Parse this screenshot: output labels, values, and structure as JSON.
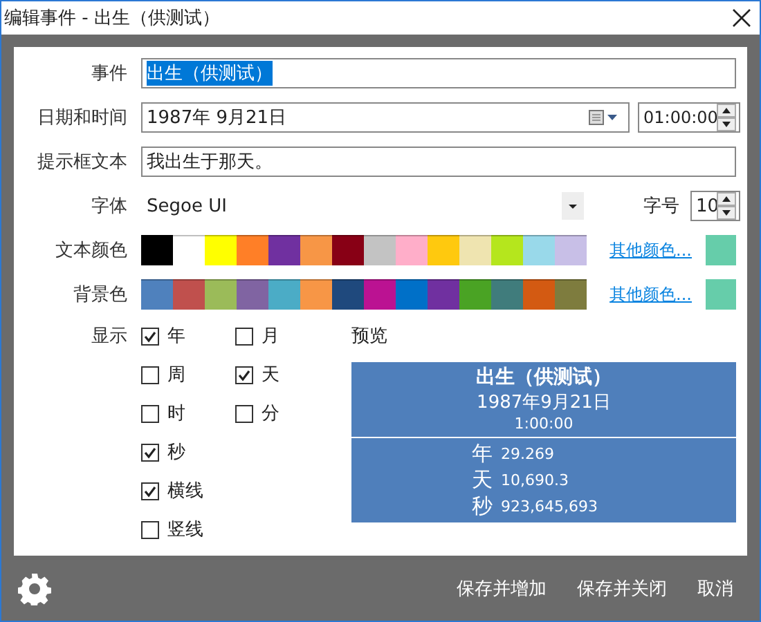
{
  "window": {
    "title": "编辑事件 - 出生（供测试）"
  },
  "event": {
    "label": "事件",
    "value": "出生（供测试）",
    "text_selected": true
  },
  "datetime": {
    "label": "日期和时间",
    "date": "1987年  9月21日",
    "time": "01:00:00"
  },
  "tooltip": {
    "label": "提示框文本",
    "value": "我出生于那天。"
  },
  "font": {
    "label": "字体",
    "value": "Segoe UI",
    "size_label": "字号",
    "size": "10"
  },
  "text_color": {
    "label": "文本颜色",
    "more_link": "其他颜色...",
    "custom_swatch": {
      "color": "#66cdaa"
    },
    "swatches": [
      {
        "color": "#000000"
      },
      {
        "color": "#ffffff"
      },
      {
        "color": "#ffff00"
      },
      {
        "color": "#ff7f27"
      },
      {
        "color": "#7030a0"
      },
      {
        "color": "#f79646"
      },
      {
        "color": "#880015"
      },
      {
        "color": "#c3c3c3"
      },
      {
        "color": "#ffaec9"
      },
      {
        "color": "#ffc90e"
      },
      {
        "color": "#efe4b0"
      },
      {
        "color": "#b5e61d"
      },
      {
        "color": "#99d9ea"
      },
      {
        "color": "#c8bfe7"
      }
    ]
  },
  "background_color": {
    "label": "背景色",
    "more_link": "其他颜色...",
    "custom_swatch": {
      "color": "#66cdaa"
    },
    "swatches": [
      {
        "color": "#4f81bd"
      },
      {
        "color": "#c0504d"
      },
      {
        "color": "#9bbb59"
      },
      {
        "color": "#8064a2"
      },
      {
        "color": "#4bacc6"
      },
      {
        "color": "#f79646"
      },
      {
        "color": "#1f497d"
      },
      {
        "color": "#bb1292"
      },
      {
        "color": "#0070c8"
      },
      {
        "color": "#7030a0"
      },
      {
        "color": "#4aa324"
      },
      {
        "color": "#407c7c"
      },
      {
        "color": "#d35a12"
      },
      {
        "color": "#7e7c3e"
      }
    ]
  },
  "display": {
    "label": "显示",
    "columns": [
      [
        {
          "label": "年",
          "checked": true
        },
        {
          "label": "周",
          "checked": false
        },
        {
          "label": "时",
          "checked": false
        },
        {
          "label": "秒",
          "checked": true
        },
        {
          "label": "横线",
          "checked": true
        },
        {
          "label": "竖线",
          "checked": false
        }
      ],
      [
        {
          "label": "月",
          "checked": false
        },
        {
          "label": "天",
          "checked": true
        },
        {
          "label": "分",
          "checked": false
        }
      ]
    ]
  },
  "preview": {
    "label": "预览",
    "title": "出生（供测试）",
    "date": "1987年9月21日",
    "time": "1:00:00",
    "stats": [
      {
        "unit": "年",
        "value": "29.269"
      },
      {
        "unit": "天",
        "value": "10,690.3"
      },
      {
        "unit": "秒",
        "value": "923,645,693"
      }
    ]
  },
  "footer": {
    "buttons": [
      "保存并增加",
      "保存并关闭",
      "取消"
    ]
  }
}
